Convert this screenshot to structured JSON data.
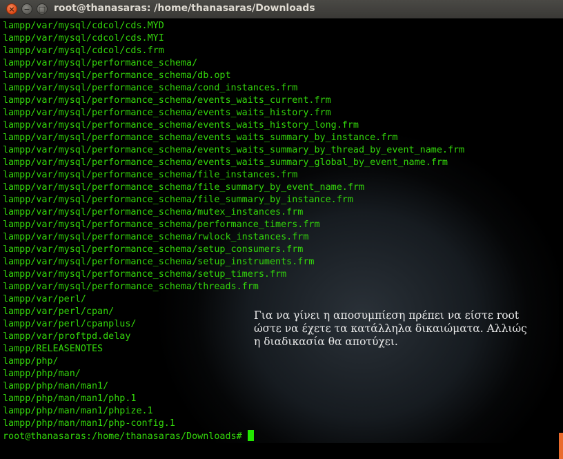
{
  "window": {
    "title": "root@thanasaras: /home/thanasaras/Downloads"
  },
  "terminal": {
    "lines": [
      "lampp/var/mysql/cdcol/cds.MYD",
      "lampp/var/mysql/cdcol/cds.MYI",
      "lampp/var/mysql/cdcol/cds.frm",
      "lampp/var/mysql/performance_schema/",
      "lampp/var/mysql/performance_schema/db.opt",
      "lampp/var/mysql/performance_schema/cond_instances.frm",
      "lampp/var/mysql/performance_schema/events_waits_current.frm",
      "lampp/var/mysql/performance_schema/events_waits_history.frm",
      "lampp/var/mysql/performance_schema/events_waits_history_long.frm",
      "lampp/var/mysql/performance_schema/events_waits_summary_by_instance.frm",
      "lampp/var/mysql/performance_schema/events_waits_summary_by_thread_by_event_name.frm",
      "lampp/var/mysql/performance_schema/events_waits_summary_global_by_event_name.frm",
      "lampp/var/mysql/performance_schema/file_instances.frm",
      "lampp/var/mysql/performance_schema/file_summary_by_event_name.frm",
      "lampp/var/mysql/performance_schema/file_summary_by_instance.frm",
      "lampp/var/mysql/performance_schema/mutex_instances.frm",
      "lampp/var/mysql/performance_schema/performance_timers.frm",
      "lampp/var/mysql/performance_schema/rwlock_instances.frm",
      "lampp/var/mysql/performance_schema/setup_consumers.frm",
      "lampp/var/mysql/performance_schema/setup_instruments.frm",
      "lampp/var/mysql/performance_schema/setup_timers.frm",
      "lampp/var/mysql/performance_schema/threads.frm",
      "lampp/var/perl/",
      "lampp/var/perl/cpan/",
      "lampp/var/perl/cpanplus/",
      "lampp/var/proftpd.delay",
      "lampp/RELEASENOTES",
      "lampp/php/",
      "lampp/php/man/",
      "lampp/php/man/man1/",
      "lampp/php/man/man1/php.1",
      "lampp/php/man/man1/phpize.1",
      "lampp/php/man/man1/php-config.1"
    ],
    "prompt": "root@thanasaras:/home/thanasaras/Downloads#"
  },
  "caption": {
    "lines": [
      "Για να γίνει η αποσυμπίεση πρέπει να είστε root",
      "ώστε να έχετε τα κατάλληλα δικαιώματα. Αλλιώς",
      "η διαδικασία θα αποτύχει."
    ]
  },
  "colors": {
    "text": "#33d60b",
    "close": "#dd4814",
    "scroll_thumb": "#e96b2d"
  },
  "icons": {
    "close": "close-icon",
    "minimize": "minimize-icon",
    "maximize": "maximize-icon"
  }
}
